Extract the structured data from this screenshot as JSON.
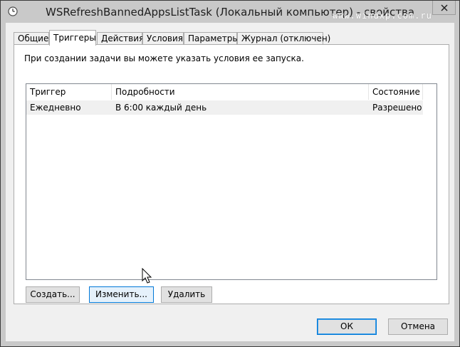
{
  "window": {
    "title": "WSRefreshBannedAppsListTask (Локальный компьютер) - свойства",
    "watermark": "www.windxp.com.ru"
  },
  "tabs": [
    {
      "label": "Общие",
      "active": false
    },
    {
      "label": "Триггеры",
      "active": true
    },
    {
      "label": "Действия",
      "active": false
    },
    {
      "label": "Условия",
      "active": false
    },
    {
      "label": "Параметры",
      "active": false
    },
    {
      "label": "Журнал (отключен)",
      "active": false
    }
  ],
  "triggers_tab": {
    "description": "При создании задачи вы можете указать условия ее запуска.",
    "columns": [
      "Триггер",
      "Подробности",
      "Состояние"
    ],
    "rows": [
      {
        "trigger": "Ежедневно",
        "details": "В 6:00 каждый день",
        "state": "Разрешено"
      }
    ],
    "buttons": {
      "create": "Создать...",
      "edit": "Изменить...",
      "delete": "Удалить"
    }
  },
  "dialog_buttons": {
    "ok": "ОК",
    "cancel": "Отмена"
  },
  "icons": {
    "title": "clock-icon",
    "close": "close-icon",
    "cursor": "mouse-pointer-icon"
  },
  "colors": {
    "frame": "#c9c9c9",
    "client": "#f0f0f0",
    "accent": "#0078d7",
    "hover": "#e5f1fb"
  }
}
